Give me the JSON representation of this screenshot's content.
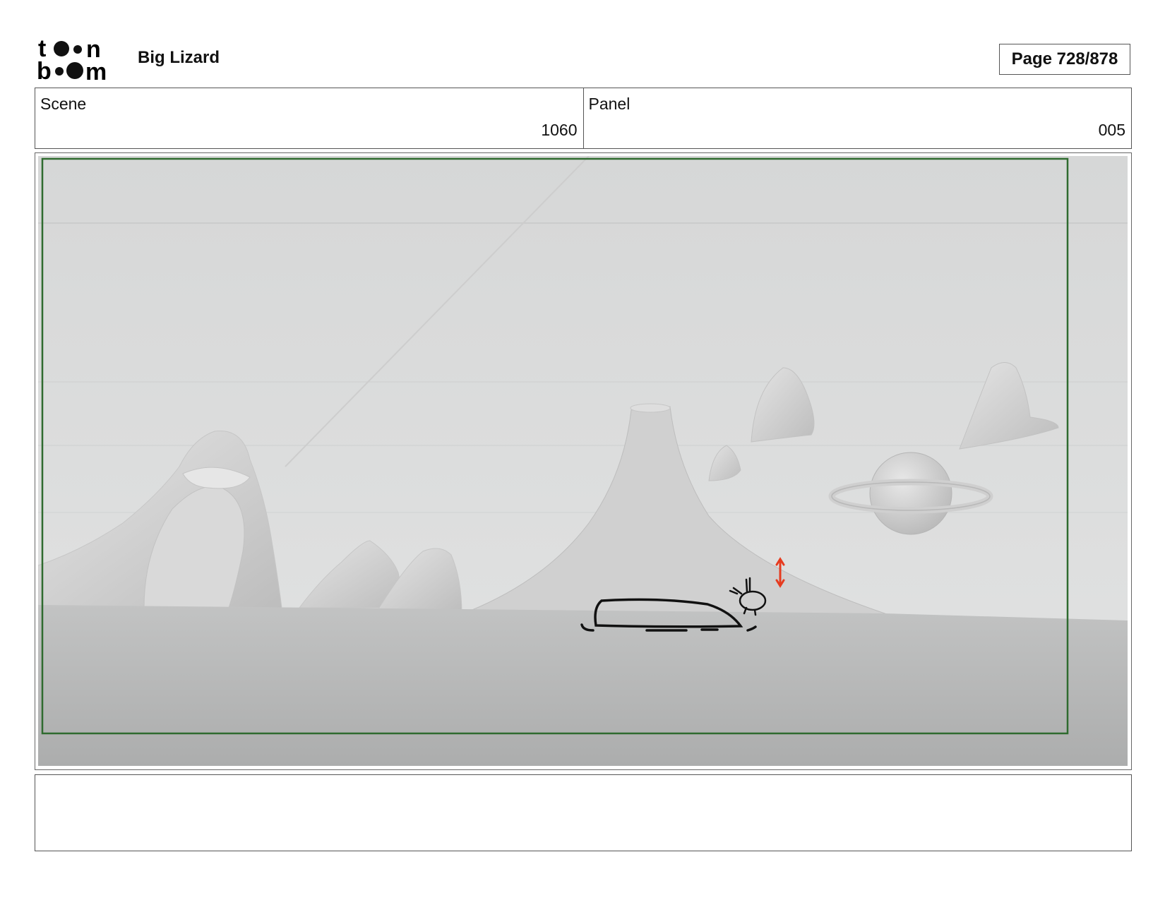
{
  "header": {
    "logo_text": "toon boom",
    "project_title": "Big Lizard",
    "page_label": "Page 728/878"
  },
  "info": {
    "scene_label": "Scene",
    "scene_value": "1060",
    "panel_label": "Panel",
    "panel_value": "005"
  },
  "notes": {
    "text": ""
  },
  "colors": {
    "safe_frame": "#2f6b2f",
    "sketch_arrow": "#e63b1f",
    "border": "#555555"
  }
}
